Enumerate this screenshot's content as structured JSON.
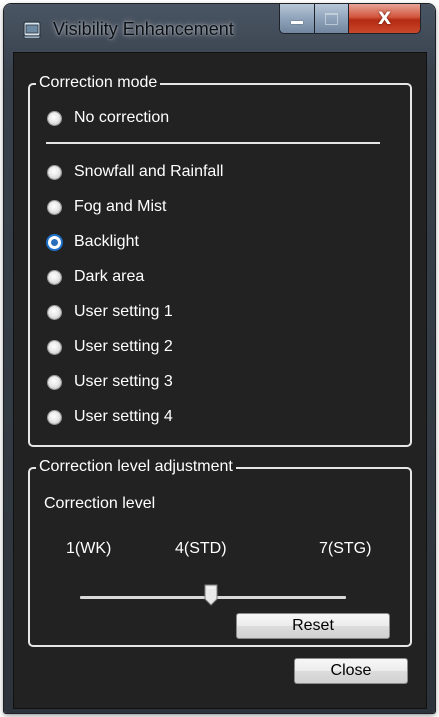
{
  "window": {
    "title": "Visibility Enhancement",
    "icon": "app-window-icon",
    "caption_buttons": [
      "minimize-icon",
      "maximize-icon",
      "close-icon"
    ],
    "close_glyph": "X"
  },
  "correction_mode": {
    "title": "Correction mode",
    "no_correction": "No correction",
    "selected": "Backlight",
    "options": [
      "Snowfall and Rainfall",
      "Fog and Mist",
      "Backlight",
      "Dark area",
      "User setting 1",
      "User setting 2",
      "User setting 3",
      "User setting 4"
    ]
  },
  "level_adjustment": {
    "title": "Correction level adjustment",
    "level_label": "Correction level",
    "min_label": "1(WK)",
    "std_label": "4(STD)",
    "max_label": "7(STG)",
    "slider_min": 1,
    "slider_max": 7,
    "slider_value": 4,
    "reset_label": "Reset"
  },
  "footer": {
    "close_label": "Close"
  },
  "colors": {
    "client_background": "#222222",
    "text": "#ffffff",
    "selected_radio": "#1e6fc8",
    "close_button": "#c9472c"
  }
}
